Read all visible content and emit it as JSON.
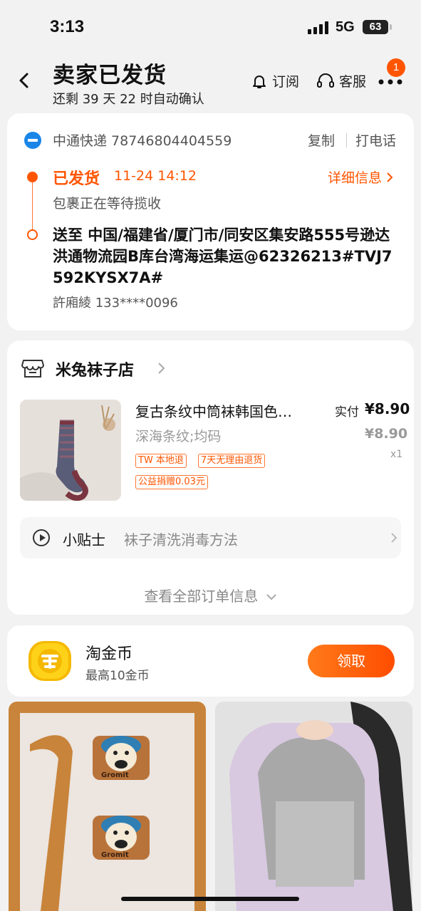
{
  "status_bar": {
    "time": "3:13",
    "network": "5G",
    "battery": "63"
  },
  "header": {
    "title": "卖家已发货",
    "subtitle": "还剩 39 天 22 时自动确认",
    "subscribe_label": "订阅",
    "service_label": "客服",
    "notification_count": "1"
  },
  "logistics": {
    "courier": "中通快递 78746804404559",
    "copy_label": "复制",
    "call_label": "打电话",
    "status": "已发货",
    "status_time": "11-24 14:12",
    "detail_label": "详细信息",
    "status_desc": "包裹正在等待揽收",
    "address": "送至 中国/福建省/厦门市/同安区集安路555号逊达洪通物流园B库台湾海运集运@62326213#TVJ7592KYSX7A#",
    "receiver": "許廂綾 133****0096"
  },
  "shop": {
    "name": "米兔袜子店",
    "product": {
      "title": "复古条纹中筒袜韩国色…",
      "paid_label": "实付",
      "paid_price": "¥8.90",
      "variant": "深海条纹;均码",
      "original_price": "¥8.90",
      "quantity": "x1",
      "tags": [
        "TW 本地退",
        "7天无理由退货",
        "公益捐赠0.03元"
      ]
    },
    "tips_label": "小贴士",
    "tips_text": "袜子清洗消毒方法",
    "view_all": "查看全部订单信息"
  },
  "coin": {
    "title": "淘金币",
    "subtitle": "最高10金币",
    "claim_label": "领取"
  },
  "feed": {
    "item1_text": "Gromit",
    "colors": {
      "accent": "#ff5500"
    }
  }
}
